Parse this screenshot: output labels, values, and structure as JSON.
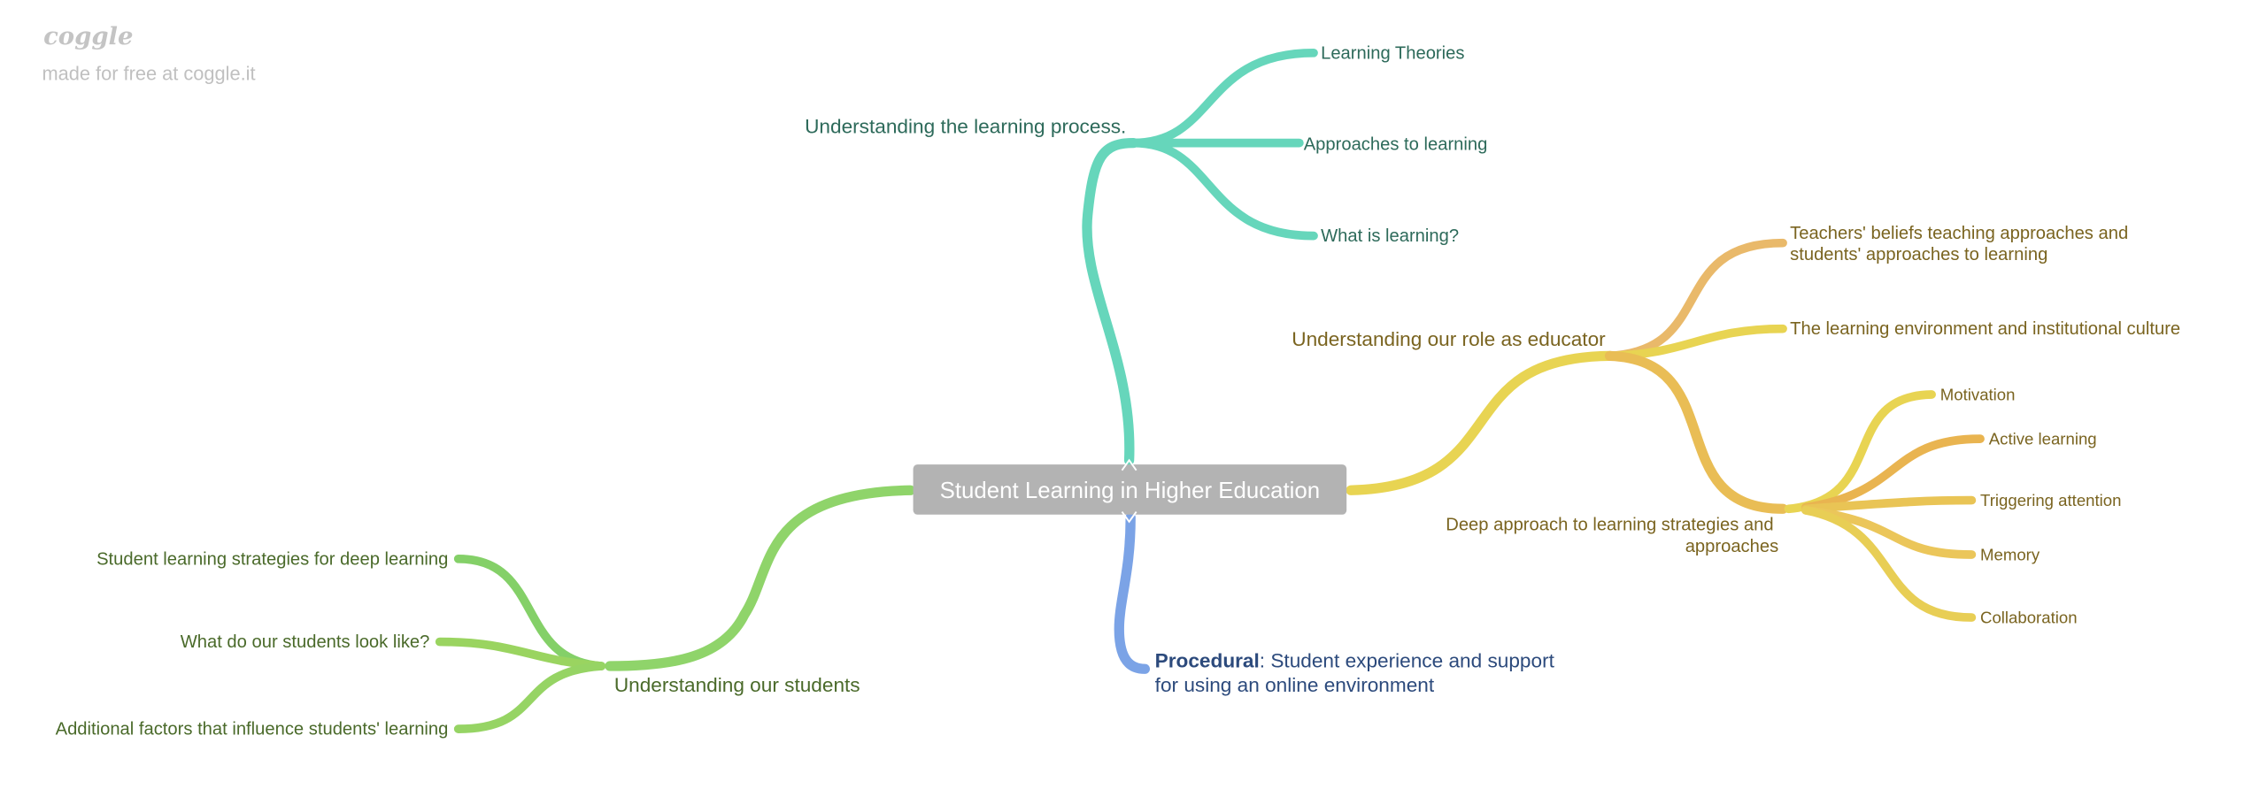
{
  "branding": {
    "logo": "coggle",
    "tagline": "made for free at coggle.it"
  },
  "colors": {
    "center": "#b3b3b3",
    "teal": "#66d6bb",
    "yellow": "#e8d452",
    "orange": "#e9b45a",
    "green": "#8fd46a",
    "blue": "#7ba3e6"
  },
  "center": {
    "label": "Student Learning in Higher Education"
  },
  "branches": {
    "process": {
      "label": "Understanding the learning process.",
      "children": [
        "Learning Theories",
        "Approaches to learning",
        "What is learning?"
      ]
    },
    "educator": {
      "label": "Understanding our role as educator",
      "teachers": [
        "Teachers' beliefs teaching approaches and",
        "students' approaches to learning"
      ],
      "environment": "The learning environment and institutional culture",
      "deep": {
        "label": [
          "Deep approach to learning strategies and",
          "approaches"
        ],
        "children": [
          "Motivation",
          "Active learning",
          "Triggering attention",
          "Memory",
          "Collaboration"
        ]
      }
    },
    "procedural": {
      "bold": "Procedural",
      "rest": ": Student experience and support",
      "line2": "for using an online environment"
    },
    "students": {
      "label": "Understanding our students",
      "children": [
        "Student learning strategies for deep learning",
        "What do our students look like?",
        "Additional factors that influence students' learning"
      ]
    }
  }
}
